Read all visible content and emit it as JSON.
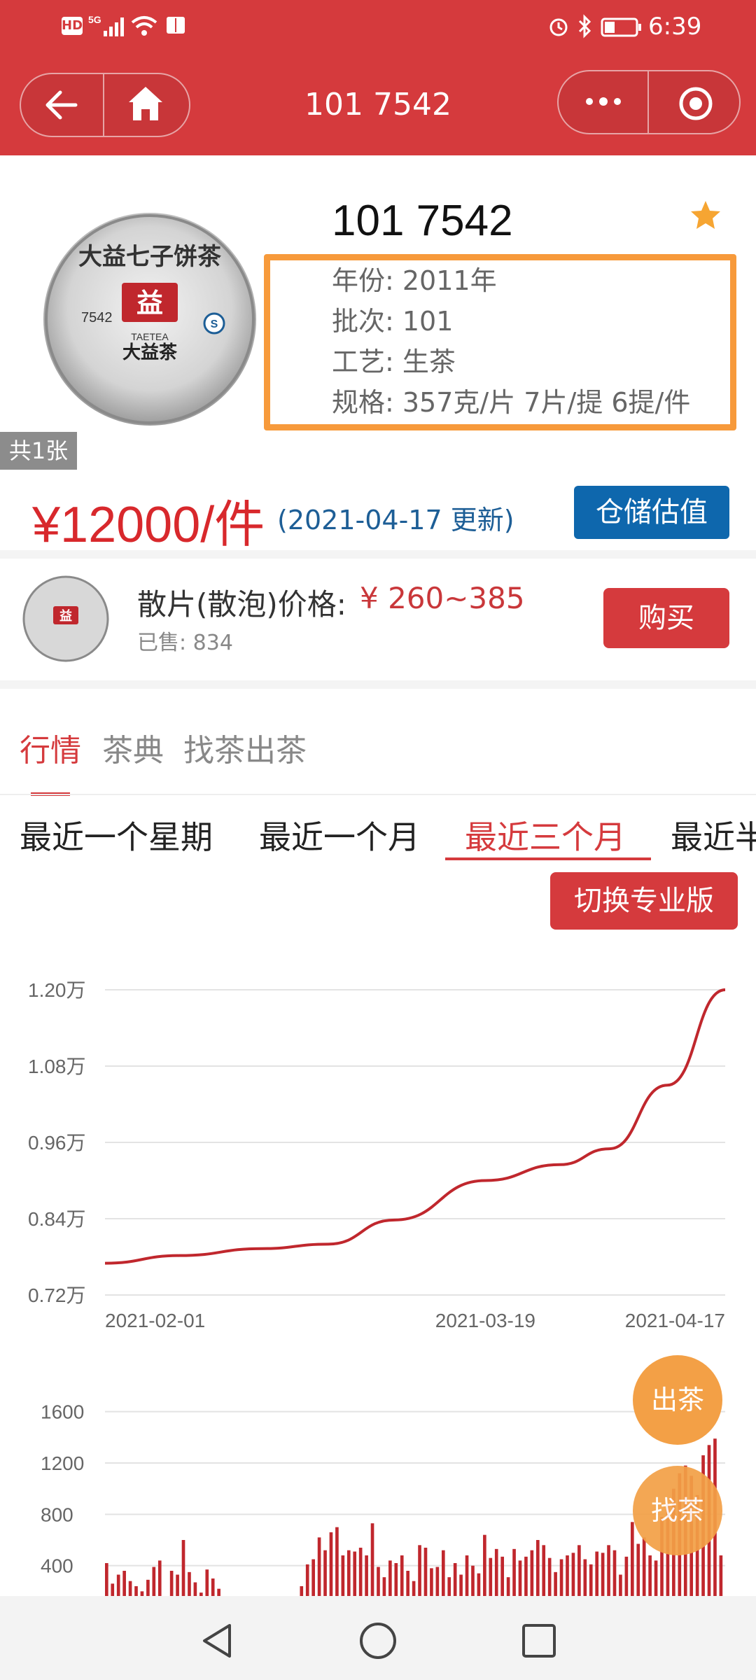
{
  "status_bar": {
    "left_icons": [
      "hd-icon",
      "5g-signal-icon",
      "wifi-icon",
      "book-icon"
    ],
    "right_icons": [
      "alarm-icon",
      "bluetooth-icon",
      "battery-icon"
    ],
    "time": "6:39"
  },
  "title_bar": {
    "title": "101 7542"
  },
  "product": {
    "name": "101 7542",
    "year": "年份: 2011年",
    "batch": "批次: 101",
    "process": "工艺: 生茶",
    "spec": "规格: 357克/片 7片/提 6提/件",
    "image_count": "共1张",
    "cake_text": {
      "top": "大益七子饼茶",
      "brand": "大益茶",
      "code": "7542",
      "sub": "TAETEA"
    },
    "price": "¥12000/件",
    "price_date": "(2021-04-17 更新)",
    "storage_button": "仓储估值"
  },
  "loose": {
    "label": "散片(散泡)价格:",
    "price": "¥ 260~385",
    "sold": "已售: 834",
    "buy_button": "购买"
  },
  "tabs": [
    "行情",
    "茶典",
    "找茶出茶"
  ],
  "active_tab": "行情",
  "ranges": [
    "最近一个星期",
    "最近一个月",
    "最近三个月",
    "最近半"
  ],
  "active_range": "最近三个月",
  "pro_button": "切换专业版",
  "fab": {
    "sell": "出茶",
    "find": "找茶"
  },
  "colors": {
    "brand_red": "#d53a3d",
    "price_red": "#d8282c",
    "accent_blue": "#0e67ad",
    "highlight_orange": "#f79a3b",
    "fab_orange": "#f3a046"
  },
  "chart_data": [
    {
      "type": "line",
      "y_tick_labels": [
        "1.20万",
        "1.08万",
        "0.96万",
        "0.84万",
        "0.72万"
      ],
      "ylim": [
        7200,
        12000
      ],
      "x_tick_labels": [
        "2021-02-01",
        "2021-03-19",
        "2021-04-17"
      ],
      "x": [
        "2021-02-01",
        "2021-02-10",
        "2021-02-20",
        "2021-02-28",
        "2021-03-08",
        "2021-03-19",
        "2021-03-28",
        "2021-04-03",
        "2021-04-10",
        "2021-04-17"
      ],
      "values": [
        7700,
        7820,
        7930,
        8000,
        8380,
        9000,
        9250,
        9500,
        10500,
        12000
      ],
      "grid": true
    },
    {
      "type": "bar",
      "y_tick_labels": [
        "1600",
        "1200",
        "800",
        "400"
      ],
      "ylim": [
        0,
        1800
      ],
      "values": [
        420,
        260,
        330,
        360,
        280,
        240,
        200,
        290,
        390,
        440,
        160,
        360,
        330,
        600,
        350,
        270,
        190,
        370,
        300,
        220,
        120,
        90,
        60,
        20,
        20,
        30,
        20,
        10,
        30,
        40,
        50,
        40,
        20,
        240,
        410,
        450,
        620,
        520,
        660,
        700,
        480,
        520,
        510,
        540,
        480,
        730,
        390,
        310,
        440,
        420,
        480,
        360,
        280,
        560,
        540,
        380,
        390,
        520,
        310,
        420,
        330,
        480,
        400,
        340,
        640,
        460,
        530,
        470,
        310,
        530,
        440,
        470,
        520,
        600,
        560,
        460,
        350,
        450,
        480,
        500,
        560,
        450,
        410,
        510,
        500,
        560,
        520,
        330,
        470,
        740,
        570,
        620,
        480,
        440,
        780,
        880,
        1000,
        1120,
        1180,
        1100,
        950,
        1260,
        1340,
        1390,
        480
      ]
    }
  ]
}
